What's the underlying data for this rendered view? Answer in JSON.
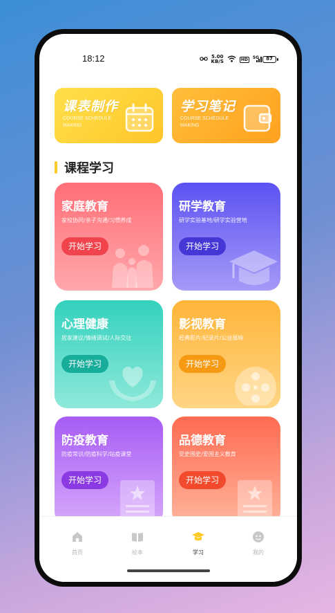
{
  "status": {
    "time": "18:12",
    "net_speed_top": "5.00",
    "net_speed_bottom": "KB/S",
    "hd": "HD",
    "signal": "5G",
    "battery": "87"
  },
  "top_cards": {
    "schedule": {
      "title": "课表制作",
      "subtitle": "COURSE SCHEDULE MAKING"
    },
    "notes": {
      "title": "学习笔记",
      "subtitle": "COURSE SCHEDULE MAKING"
    }
  },
  "section": {
    "title": "课程学习"
  },
  "courses": [
    {
      "title": "家庭教育",
      "subtitle": "家校协同/亲子沟通/习惯养成",
      "button": "开始学习"
    },
    {
      "title": "研学教育",
      "subtitle": "研学实验基地/研学实验营地",
      "button": "开始学习"
    },
    {
      "title": "心理健康",
      "subtitle": "居家建议/情绪调试/人际交往",
      "button": "开始学习"
    },
    {
      "title": "影视教育",
      "subtitle": "经典影片/纪录片/公益展映",
      "button": "开始学习"
    },
    {
      "title": "防疫教育",
      "subtitle": "防疫常识/防疫科学/站疫课堂",
      "button": "开始学习"
    },
    {
      "title": "品德教育",
      "subtitle": "党史国史/爱国主义教育",
      "button": "开始学习"
    }
  ],
  "tabs": [
    {
      "label": "首页",
      "icon": "home-icon",
      "active": false
    },
    {
      "label": "绘本",
      "icon": "book-icon",
      "active": false
    },
    {
      "label": "学习",
      "icon": "graduation-cap-icon",
      "active": true
    },
    {
      "label": "我的",
      "icon": "profile-icon",
      "active": false
    }
  ],
  "colors": {
    "accent": "#ffc928",
    "tab_inactive": "#b4b4b4"
  }
}
